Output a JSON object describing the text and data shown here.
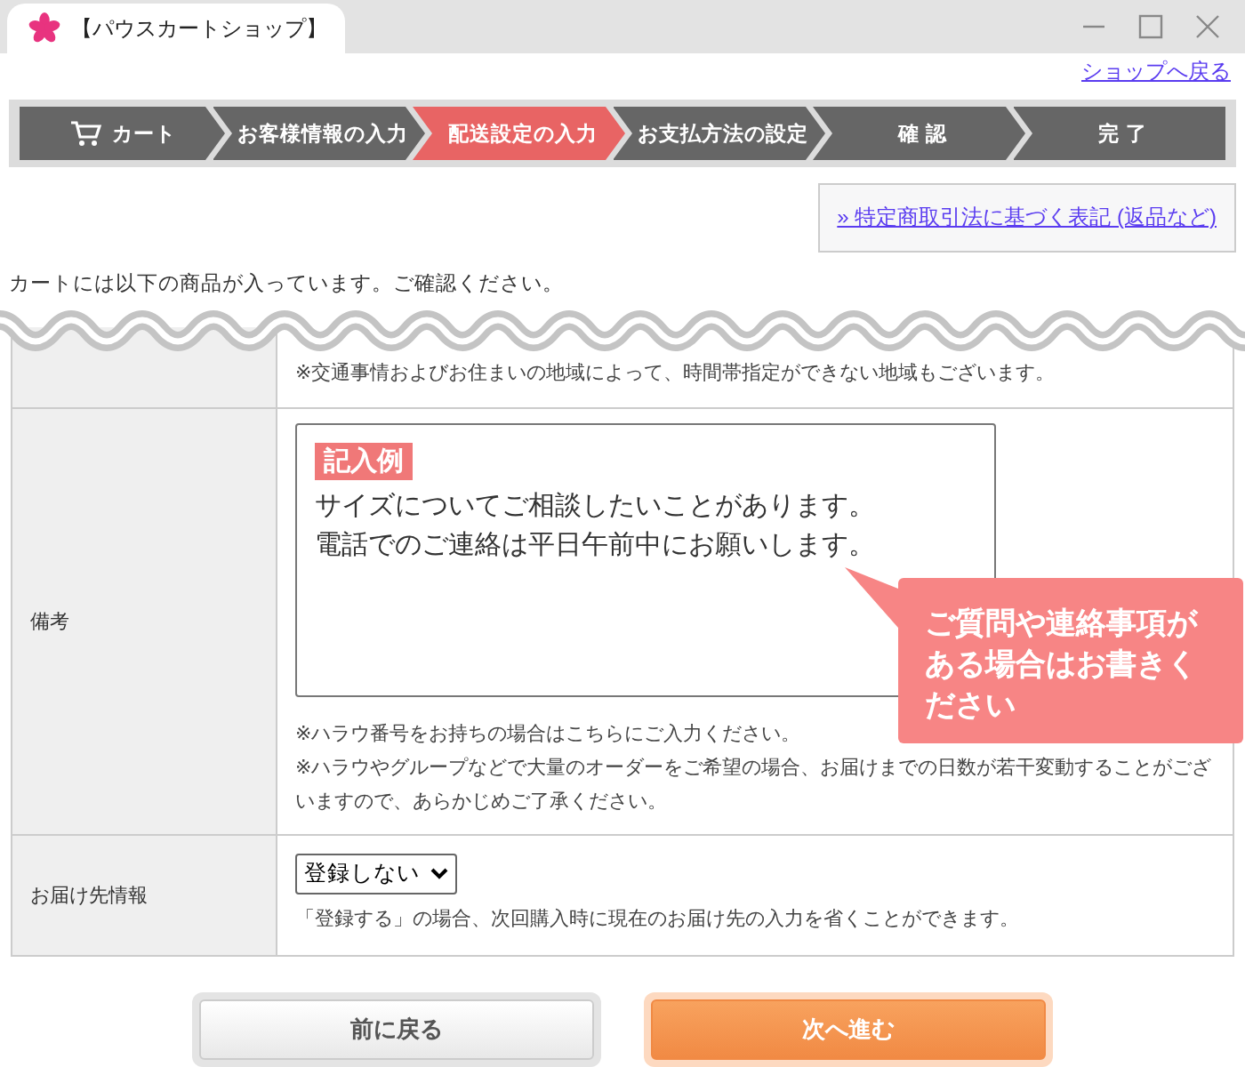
{
  "browser_tab": {
    "title": "【パウスカートショップ】"
  },
  "back_to_shop_link": "ショップへ戻る",
  "steps": [
    {
      "label": "カート",
      "kind": "cart",
      "selected": false
    },
    {
      "label": "お客様情報の入力",
      "kind": "plain",
      "selected": false
    },
    {
      "label": "配送設定の入力",
      "kind": "plain",
      "selected": true
    },
    {
      "label": "お支払方法の設定",
      "kind": "plain",
      "selected": false
    },
    {
      "label": "確 認",
      "kind": "plain",
      "selected": false
    },
    {
      "label": "完 了",
      "kind": "plain",
      "selected": false
    }
  ],
  "legal_link": "» 特定商取引法に基づく表記 (返品など)",
  "intro": "カートには以下の商品が入っています。ご確認ください。",
  "cut_row": {
    "notes": [
      "※交通事情およびお住まいの地域によって、時間帯指定ができない地域もございます。"
    ]
  },
  "remarks_row": {
    "label": "備考",
    "example_badge": "記入例",
    "example_text": [
      "サイズについてご相談したいことがあります。",
      "電話でのご連絡は平日午前中にお願いします。"
    ],
    "callout": "ご質問や連絡事項がある場合はお書きください",
    "notes": [
      "※ハラウ番号をお持ちの場合はこちらにご入力ください。",
      "※ハラウやグループなどで大量のオーダーをご希望の場合、お届けまでの日数が若干変動することがございますので、あらかじめご了承ください。"
    ]
  },
  "delivery_row": {
    "label": "お届け先情報",
    "select_value": "登録しない",
    "note": "「登録する」の場合、次回購入時に現在のお届け先の入力を省くことができます。"
  },
  "buttons": {
    "back": "前に戻る",
    "next": "次へ進む"
  }
}
